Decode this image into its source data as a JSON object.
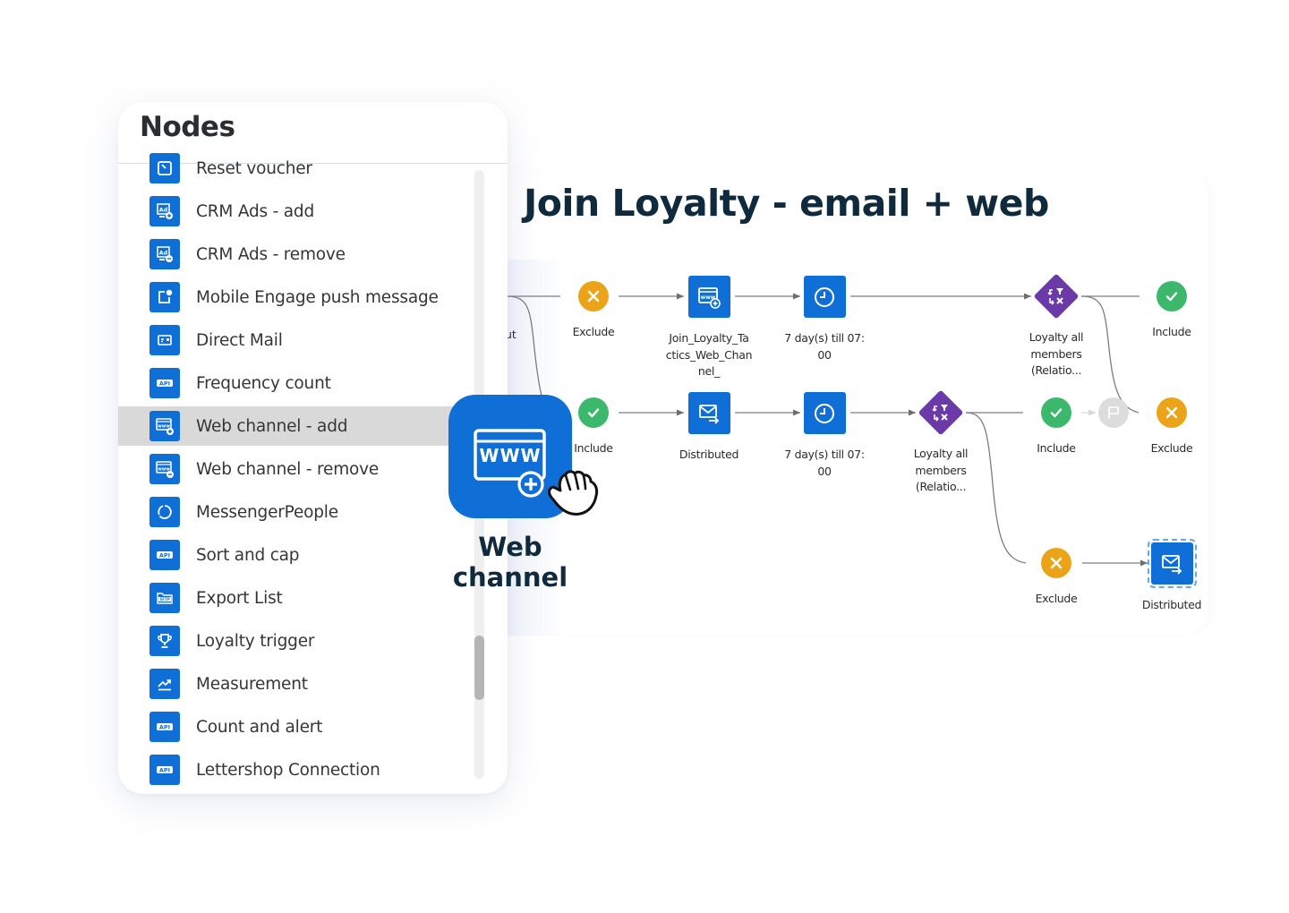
{
  "nodes_panel": {
    "title": "Nodes",
    "items": [
      {
        "label": "Reset voucher",
        "icon": "reset-voucher-icon"
      },
      {
        "label": "CRM Ads - add",
        "icon": "ad-add-icon"
      },
      {
        "label": "CRM Ads - remove",
        "icon": "ad-remove-icon"
      },
      {
        "label": "Mobile Engage push message",
        "icon": "push-notification-icon"
      },
      {
        "label": "Direct Mail",
        "icon": "direct-mail-icon"
      },
      {
        "label": "Frequency count",
        "icon": "api-icon"
      },
      {
        "label": "Web channel - add",
        "icon": "web-add-icon",
        "active": true
      },
      {
        "label": "Web channel - remove",
        "icon": "web-remove-icon"
      },
      {
        "label": "MessengerPeople",
        "icon": "messenger-icon"
      },
      {
        "label": "Sort and cap",
        "icon": "api-icon"
      },
      {
        "label": "Export List",
        "icon": "sftp-folder-icon"
      },
      {
        "label": "Loyalty trigger",
        "icon": "trophy-icon"
      },
      {
        "label": "Measurement",
        "icon": "trend-chart-icon"
      },
      {
        "label": "Count and alert",
        "icon": "api-icon"
      },
      {
        "label": "Lettershop Connection",
        "icon": "api-icon"
      }
    ],
    "api_badge": "API",
    "sftp_badge": "SFTP",
    "ad_badge": "Ad",
    "www_badge": "www"
  },
  "drag_preview": {
    "icon_text": "WWW",
    "caption_line1": "Web",
    "caption_line2": "channel"
  },
  "workflow": {
    "title": "Join Loyalty - email + web",
    "partial_label": "ut",
    "nodes": {
      "exclude_top": "Exclude",
      "join_web": "Join_Loyalty_Ta ctics_Web_Chan nel_",
      "wait_top": "7 day(s) till 07: 00",
      "split_top": "Loyalty all members (Relatio...",
      "include_top_right": "Include",
      "include_mid": "Include",
      "distributed_mid": "Distributed",
      "wait_mid": "7 day(s) till 07: 00",
      "split_mid": "Loyalty all members (Relatio...",
      "include_mid_right": "Include",
      "exclude_mid_right": "Exclude",
      "exclude_bottom": "Exclude",
      "distributed_bottom": "Distributed"
    }
  },
  "colors": {
    "primary_blue": "#0f6fd6",
    "include_green": "#3bb86b",
    "exclude_orange": "#eba41a",
    "split_purple": "#6b3aa8",
    "title_navy": "#0f2a3d"
  }
}
